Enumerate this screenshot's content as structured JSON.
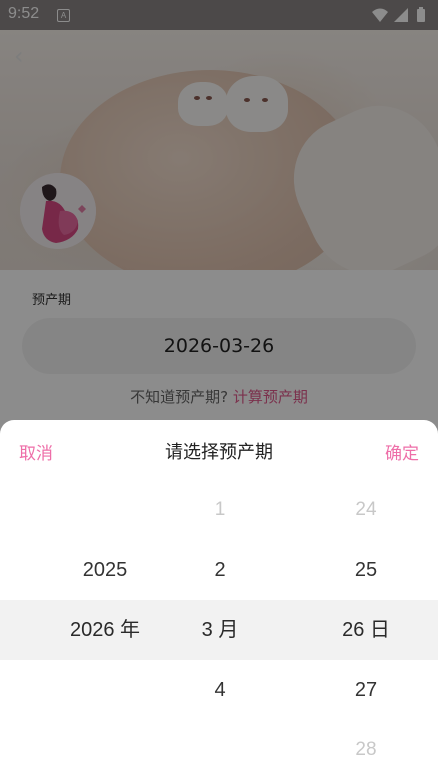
{
  "status_bar": {
    "time": "9:52",
    "notification_icon": "A",
    "icons": [
      "wifi-icon",
      "signal-icon",
      "battery-icon"
    ]
  },
  "header": {
    "back_icon": "chevron-left-icon",
    "avatar_icon": "pregnant-woman-icon"
  },
  "form": {
    "label": "预产期",
    "date_value": "2026-03-26",
    "hint_text": "不知道预产期?",
    "hint_link": "计算预产期"
  },
  "picker": {
    "cancel": "取消",
    "title": "请选择预产期",
    "confirm": "确定",
    "year": {
      "above": "2025",
      "selected": "2026 年"
    },
    "month": {
      "above2": "1",
      "above1": "2",
      "selected": "3 月",
      "below1": "4"
    },
    "day": {
      "above2": "24",
      "above1": "25",
      "selected": "26 日",
      "below1": "27",
      "below2": "28"
    }
  },
  "colors": {
    "accent": "#ee6ea8",
    "link": "#e05a8c",
    "overlay": "rgba(0,0,0,0.45)"
  }
}
